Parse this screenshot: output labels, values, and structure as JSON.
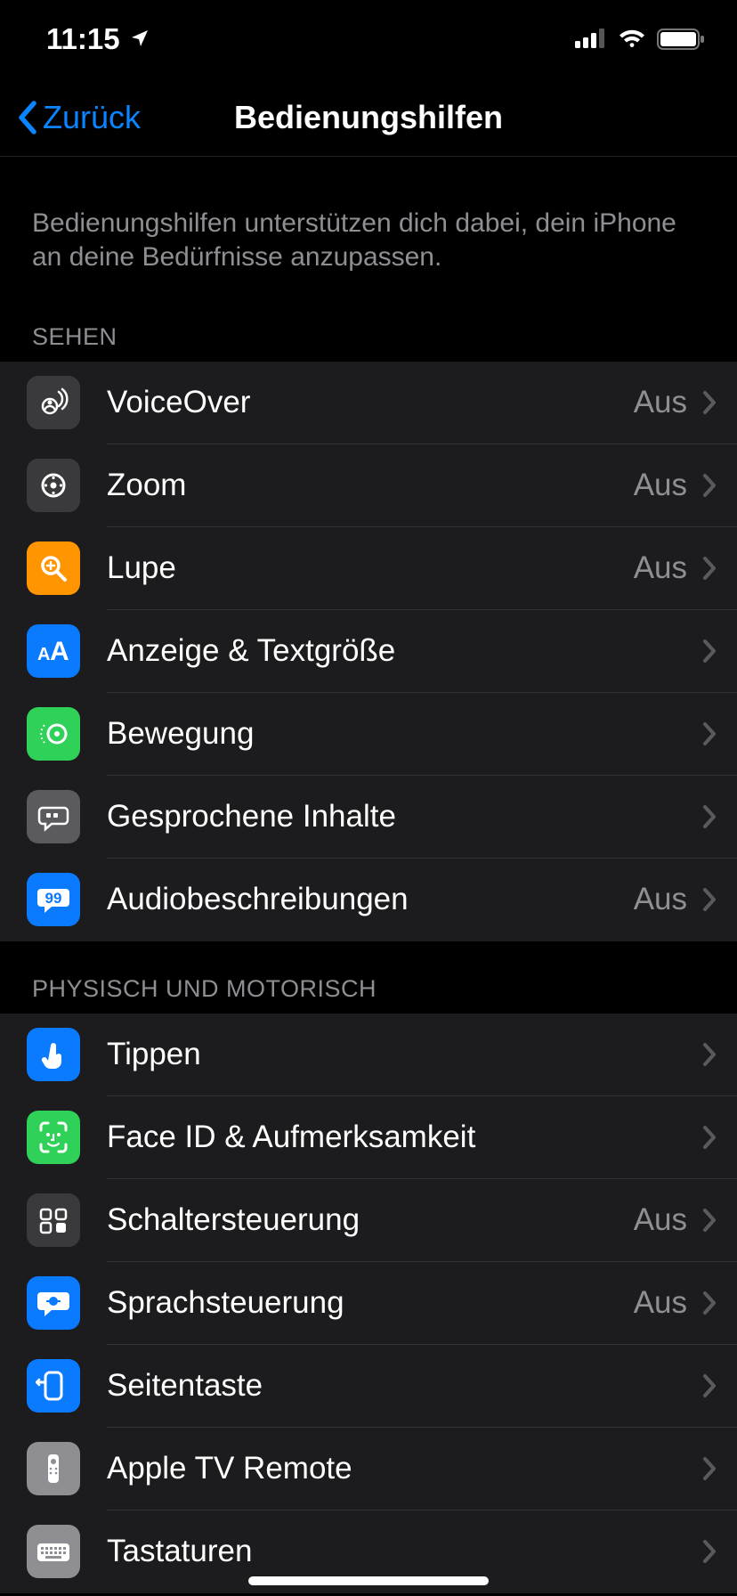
{
  "status": {
    "time": "11:15"
  },
  "nav": {
    "back": "Zurück",
    "title": "Bedienungshilfen"
  },
  "intro": "Bedienungshilfen unterstützen dich dabei, dein iPhone an deine Bedürfnisse anzupassen.",
  "value_off": "Aus",
  "sections": [
    {
      "header": "SEHEN",
      "items": [
        {
          "id": "voiceover",
          "label": "VoiceOver",
          "value": "Aus",
          "icon": "voiceover-icon",
          "bg": "bg-dgrey"
        },
        {
          "id": "zoom",
          "label": "Zoom",
          "value": "Aus",
          "icon": "zoom-icon",
          "bg": "bg-dgrey"
        },
        {
          "id": "lupe",
          "label": "Lupe",
          "value": "Aus",
          "icon": "magnifier-icon",
          "bg": "bg-orange"
        },
        {
          "id": "display",
          "label": "Anzeige & Textgröße",
          "value": "",
          "icon": "textsize-icon",
          "bg": "bg-blue"
        },
        {
          "id": "motion",
          "label": "Bewegung",
          "value": "",
          "icon": "motion-icon",
          "bg": "bg-green"
        },
        {
          "id": "spoken",
          "label": "Gesprochene Inhalte",
          "value": "",
          "icon": "speech-icon",
          "bg": "bg-grey"
        },
        {
          "id": "audiodesc",
          "label": "Audiobeschreibungen",
          "value": "Aus",
          "icon": "audiodesc-icon",
          "bg": "bg-blue"
        }
      ]
    },
    {
      "header": "PHYSISCH UND MOTORISCH",
      "items": [
        {
          "id": "touch",
          "label": "Tippen",
          "value": "",
          "icon": "touch-icon",
          "bg": "bg-blue"
        },
        {
          "id": "faceid",
          "label": "Face ID & Aufmerksamkeit",
          "value": "",
          "icon": "faceid-icon",
          "bg": "bg-green"
        },
        {
          "id": "switch",
          "label": "Schaltersteuerung",
          "value": "Aus",
          "icon": "switch-icon",
          "bg": "bg-dgrey"
        },
        {
          "id": "voice",
          "label": "Sprachsteuerung",
          "value": "Aus",
          "icon": "voice-icon",
          "bg": "bg-blue"
        },
        {
          "id": "side",
          "label": "Seitentaste",
          "value": "",
          "icon": "sidebutton-icon",
          "bg": "bg-blue"
        },
        {
          "id": "appletv",
          "label": "Apple TV Remote",
          "value": "",
          "icon": "remote-icon",
          "bg": "bg-lgrey"
        },
        {
          "id": "keyboard",
          "label": "Tastaturen",
          "value": "",
          "icon": "keyboard-icon",
          "bg": "bg-lgrey"
        }
      ]
    }
  ]
}
